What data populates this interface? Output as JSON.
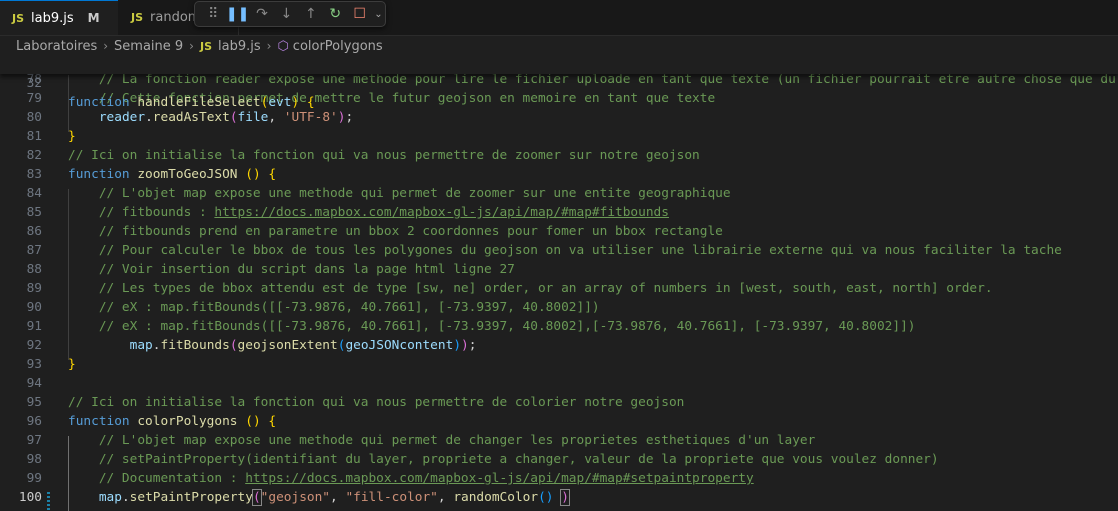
{
  "tabs": [
    {
      "label": "lab9.js",
      "badge": "M",
      "icon": "js-icon",
      "modified": true
    },
    {
      "label": "randomColor.js",
      "icon": "js-icon"
    }
  ],
  "js_label": "JS",
  "debug_toolbar": {
    "icons": [
      "gripper-icon",
      "pause-icon",
      "step-over-icon",
      "step-into-icon",
      "step-out-icon",
      "restart-icon",
      "stop-icon",
      "chevron-down-icon"
    ]
  },
  "breadcrumb": [
    "Laboratoires",
    "Semaine 9",
    "lab9.js",
    "colorPolygons"
  ],
  "sticky": {
    "num": "32",
    "tokens": [
      [
        "k",
        "function "
      ],
      [
        "f",
        "handleFileSelect"
      ],
      [
        "b1",
        "("
      ],
      [
        "v",
        "evt"
      ],
      [
        "b1",
        ")"
      ],
      [
        "p",
        " "
      ],
      [
        "b1",
        "{"
      ]
    ]
  },
  "lines": [
    {
      "num": "78",
      "tokens": [
        [
          "c",
          "    // La fonction reader expose une methode pour lire le fichier uploade en tant que texte (un fichier pourrait etre autre chose que du"
        ]
      ]
    },
    {
      "num": "79",
      "tokens": [
        [
          "c",
          "    // Cette fonction permet de mettre le futur geojson en memoire en tant que texte"
        ]
      ]
    },
    {
      "num": "80",
      "tokens": [
        [
          "p",
          "    "
        ],
        [
          "v",
          "reader"
        ],
        [
          "p",
          "."
        ],
        [
          "f",
          "readAsText"
        ],
        [
          "b2",
          "("
        ],
        [
          "v",
          "file"
        ],
        [
          "p",
          ", "
        ],
        [
          "s",
          "'UTF-8'"
        ],
        [
          "b2",
          ")"
        ],
        [
          "p",
          ";"
        ]
      ]
    },
    {
      "num": "81",
      "tokens": [
        [
          "b1",
          "}"
        ]
      ]
    },
    {
      "num": "82",
      "tokens": [
        [
          "c",
          "// Ici on initialise la fonction qui va nous permettre de zoomer sur notre geojson"
        ]
      ]
    },
    {
      "num": "83",
      "tokens": [
        [
          "k",
          "function "
        ],
        [
          "f",
          "zoomToGeoJSON"
        ],
        [
          "p",
          " "
        ],
        [
          "b1",
          "()"
        ],
        [
          "p",
          " "
        ],
        [
          "b1",
          "{"
        ]
      ]
    },
    {
      "num": "84",
      "tokens": [
        [
          "c",
          "    // L'objet map expose une methode qui permet de zoomer sur une entite geographique"
        ]
      ]
    },
    {
      "num": "85",
      "tokens": [
        [
          "c",
          "    // fitbounds : "
        ],
        [
          "c u",
          "https://docs.mapbox.com/mapbox-gl-js/api/map/#map#fitbounds"
        ]
      ]
    },
    {
      "num": "86",
      "tokens": [
        [
          "c",
          "    // fitbounds prend en parametre un bbox 2 coordonnes pour fomer un bbox rectangle"
        ]
      ]
    },
    {
      "num": "87",
      "tokens": [
        [
          "c",
          "    // Pour calculer le bbox de tous les polygones du geojson on va utiliser une librairie externe qui va nous faciliter la tache"
        ]
      ]
    },
    {
      "num": "88",
      "tokens": [
        [
          "c",
          "    // Voir insertion du script dans la page html ligne 27"
        ]
      ]
    },
    {
      "num": "89",
      "tokens": [
        [
          "c",
          "    // Les types de bbox attendu est de type [sw, ne] order, or an array of numbers in [west, south, east, north] order."
        ]
      ]
    },
    {
      "num": "90",
      "tokens": [
        [
          "c",
          "    // eX : map.fitBounds([[-73.9876, 40.7661], [-73.9397, 40.8002]])"
        ]
      ]
    },
    {
      "num": "91",
      "tokens": [
        [
          "c",
          "    // eX : map.fitBounds([[-73.9876, 40.7661], [-73.9397, 40.8002],[-73.9876, 40.7661], [-73.9397, 40.8002]])"
        ]
      ]
    },
    {
      "num": "92",
      "tokens": [
        [
          "p",
          "        "
        ],
        [
          "v",
          "map"
        ],
        [
          "p",
          "."
        ],
        [
          "f",
          "fitBounds"
        ],
        [
          "b2",
          "("
        ],
        [
          "f",
          "geojsonExtent"
        ],
        [
          "b3",
          "("
        ],
        [
          "v",
          "geoJSONcontent"
        ],
        [
          "b3",
          ")"
        ],
        [
          "b2",
          ")"
        ],
        [
          "p",
          ";"
        ]
      ]
    },
    {
      "num": "93",
      "tokens": [
        [
          "b1",
          "}"
        ]
      ]
    },
    {
      "num": "94",
      "tokens": []
    },
    {
      "num": "95",
      "tokens": [
        [
          "c",
          "// Ici on initialise la fonction qui va nous permettre de colorier notre geojson"
        ]
      ]
    },
    {
      "num": "96",
      "tokens": [
        [
          "k",
          "function "
        ],
        [
          "f",
          "colorPolygons"
        ],
        [
          "p",
          " "
        ],
        [
          "b1",
          "()"
        ],
        [
          "p",
          " "
        ],
        [
          "b1",
          "{"
        ]
      ]
    },
    {
      "num": "97",
      "tokens": [
        [
          "c",
          "    // L'objet map expose une methode qui permet de changer les proprietes esthetiques d'un layer"
        ]
      ]
    },
    {
      "num": "98",
      "tokens": [
        [
          "c",
          "    // setPaintProperty(identifiant du layer, propriete a changer, valeur de la propriete que vous voulez donner)"
        ]
      ]
    },
    {
      "num": "99",
      "tokens": [
        [
          "c",
          "    // Documentation : "
        ],
        [
          "c u",
          "https://docs.mapbox.com/mapbox-gl-js/api/map/#map#setpaintproperty"
        ]
      ]
    },
    {
      "num": "100",
      "current": true,
      "tokens": [
        [
          "p",
          "    "
        ],
        [
          "v",
          "map"
        ],
        [
          "p",
          "."
        ],
        [
          "f",
          "setPaintProperty"
        ],
        [
          "b2 boxb",
          "("
        ],
        [
          "s",
          "\"geojson\""
        ],
        [
          "p",
          ", "
        ],
        [
          "s",
          "\"fill-color\""
        ],
        [
          "p",
          ", "
        ],
        [
          "f",
          "randomColor"
        ],
        [
          "b3",
          "()"
        ],
        [
          "p",
          " "
        ],
        [
          "b2 boxb",
          ")"
        ]
      ]
    }
  ]
}
